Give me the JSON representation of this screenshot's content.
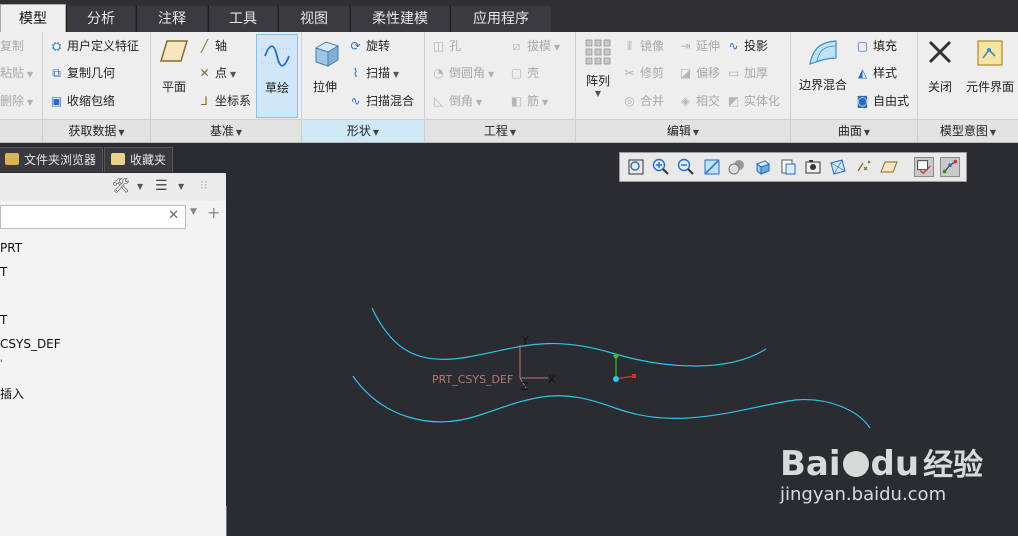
{
  "tabs": [
    {
      "label": "模型",
      "active": true
    },
    {
      "label": "分析"
    },
    {
      "label": "注释"
    },
    {
      "label": "工具"
    },
    {
      "label": "视图"
    },
    {
      "label": "柔性建模"
    },
    {
      "label": "应用程序"
    }
  ],
  "ribbon": {
    "clipboard": {
      "copy": "复制",
      "paste": "粘贴",
      "delete": "删除"
    },
    "get_data": {
      "label": "获取数据",
      "user_feature": "用户定义特征",
      "copy_geometry": "复制几何",
      "shrinkwrap": "收缩包络"
    },
    "datum": {
      "label": "基准",
      "plane": "平面",
      "axis": "轴",
      "point": "点",
      "csys": "坐标系",
      "sketch": "草绘"
    },
    "shapes": {
      "label": "形状",
      "extrude": "拉伸",
      "revolve": "旋转",
      "sweep": "扫描",
      "swept_blend": "扫描混合"
    },
    "engineering": {
      "label": "工程",
      "hole": "孔",
      "draft": "拔模",
      "round": "倒圆角",
      "shell": "壳",
      "chamfer": "倒角",
      "rib": "筋"
    },
    "editing": {
      "label": "编辑",
      "pattern": "阵列",
      "mirror": "镜像",
      "extend": "延伸",
      "project": "投影",
      "trim": "修剪",
      "offset": "偏移",
      "thicken": "加厚",
      "merge": "合并",
      "intersect": "相交",
      "solidify": "实体化"
    },
    "surfaces": {
      "label": "曲面",
      "boundary_blend": "边界混合",
      "fill": "填充",
      "style": "样式",
      "freestyle": "自由式"
    },
    "model_intent": {
      "label": "模型意图",
      "close": "关闭",
      "component_interface": "元件界面"
    }
  },
  "navigator": {
    "tab_folder_browser": "文件夹浏览器",
    "tab_favorites": "收藏夹",
    "tree": [
      "PRT",
      "T",
      "T",
      "CSYS_DEF",
      "",
      "插入"
    ]
  },
  "canvas": {
    "csys_label": "PRT_CSYS_DEF",
    "axis_y": "Y",
    "axis_x": "X",
    "axis_z": "Z"
  },
  "watermark": {
    "brand": "Bai",
    "brand2": "du",
    "product": "经验",
    "url": "jingyan.baidu.com"
  },
  "colors": {
    "curve": "#2fc6e6",
    "background": "#2b2c31",
    "ribbon": "#eeeeee"
  }
}
